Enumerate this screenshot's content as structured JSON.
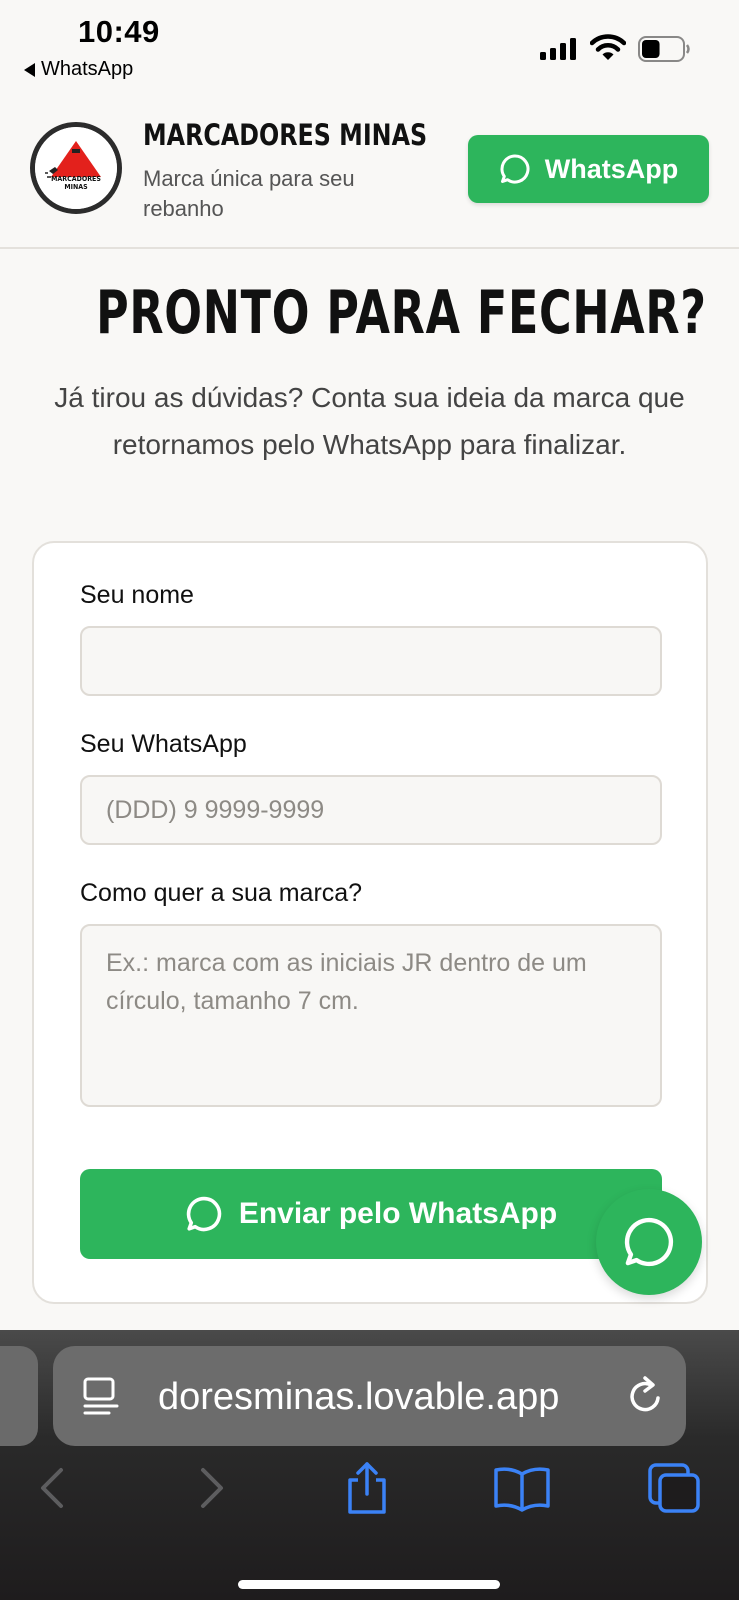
{
  "status_bar": {
    "time": "10:49",
    "back_app": "WhatsApp",
    "battery_level_percent": 45
  },
  "header": {
    "brand_title": "MARCADORES MINAS",
    "brand_subtitle": "Marca única para seu rebanho",
    "logo_text": "MARCADORES MINAS",
    "whatsapp_button": "WhatsApp"
  },
  "main": {
    "heading": "PRONTO PARA FECHAR?",
    "lead": "Já tirou as dúvidas? Conta sua ideia da marca que retornamos pelo WhatsApp para finalizar."
  },
  "form": {
    "name_label": "Seu nome",
    "name_value": "",
    "name_placeholder": "",
    "whatsapp_label": "Seu WhatsApp",
    "whatsapp_placeholder": "(DDD) 9 9999-9999",
    "brand_label": "Como quer a sua marca?",
    "brand_placeholder": "Ex.: marca com as iniciais JR dentro de um círculo, tamanho 7 cm.",
    "submit_label": "Enviar pelo WhatsApp"
  },
  "browser": {
    "url": "doresminas.lovable.app"
  },
  "colors": {
    "accent_green": "#2db55c",
    "background": "#f9f8f6",
    "logo_red": "#e3211c"
  }
}
